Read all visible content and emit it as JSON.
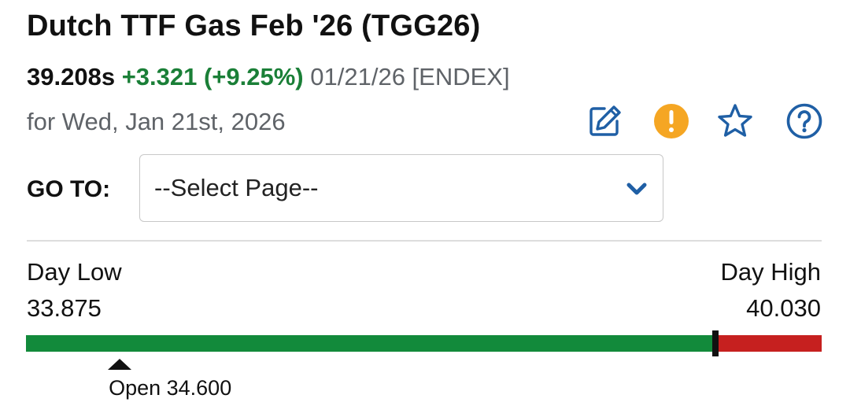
{
  "header": {
    "title": "Dutch TTF Gas Feb '26 (TGG26)",
    "last_price": "39.208s",
    "change": "+3.321 (+9.25%)",
    "trade_date": "01/21/26 [ENDEX]",
    "for_date": "for Wed, Jan 21st, 2026"
  },
  "toolbar": {
    "icons": [
      "edit-icon",
      "alert-icon",
      "star-icon",
      "help-icon"
    ]
  },
  "goto": {
    "label": "GO TO:",
    "select_value": "--Select Page--"
  },
  "day_range": {
    "low_label": "Day Low",
    "low_value": "33.875",
    "high_label": "Day High",
    "high_value": "40.030",
    "low": 33.875,
    "high": 40.03,
    "last": 39.208,
    "open": 34.6,
    "open_label": "Open 34.600"
  },
  "colors": {
    "positive": "#1a7f37",
    "bar_green": "#128a3b",
    "bar_red": "#c6201f",
    "icon_blue": "#1f5fa5",
    "alert_orange": "#f5a623"
  }
}
